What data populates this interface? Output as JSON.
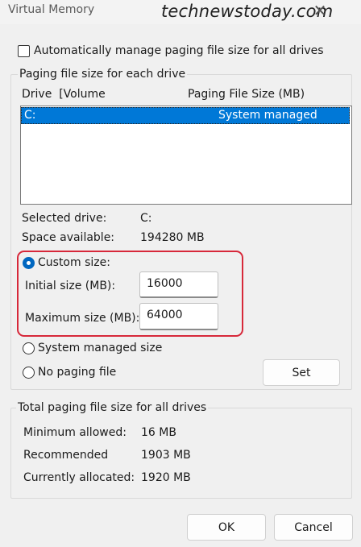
{
  "window": {
    "title": "Virtual Memory",
    "watermark": "technewstoday.com",
    "close_glyph": "✕"
  },
  "auto_manage": {
    "label": "Automatically manage paging file size for all drives",
    "checked": false
  },
  "paging_group": {
    "legend": "Paging file size for each drive",
    "columns": [
      "Drive  [Volume",
      "Paging File Size (MB)"
    ],
    "rows": [
      {
        "drive": "C:",
        "size": "System managed",
        "selected": true
      }
    ]
  },
  "selected_drive": {
    "label": "Selected drive:",
    "value": "C:"
  },
  "space_available": {
    "label": "Space available:",
    "value": "194280 MB"
  },
  "custom_size": {
    "label": "Custom size:",
    "selected": true,
    "initial_label": "Initial size (MB):",
    "initial_value": "16000",
    "maximum_label": "Maximum size (MB):",
    "maximum_value": "64000"
  },
  "system_managed": {
    "label": "System managed size",
    "selected": false
  },
  "no_paging": {
    "label": "No paging file",
    "selected": false
  },
  "set_button": "Set",
  "totals_group": {
    "legend": "Total paging file size for all drives",
    "minimum": {
      "label": "Minimum allowed:",
      "value": "16 MB"
    },
    "recommended": {
      "label": "Recommended",
      "value": "1903 MB"
    },
    "allocated": {
      "label": "Currently allocated:",
      "value": "1920 MB"
    }
  },
  "ok_button": "OK",
  "cancel_button": "Cancel",
  "colors": {
    "selection": "#0078d7",
    "highlight_box": "#d7283a",
    "radio_selected": "#0067c0"
  }
}
